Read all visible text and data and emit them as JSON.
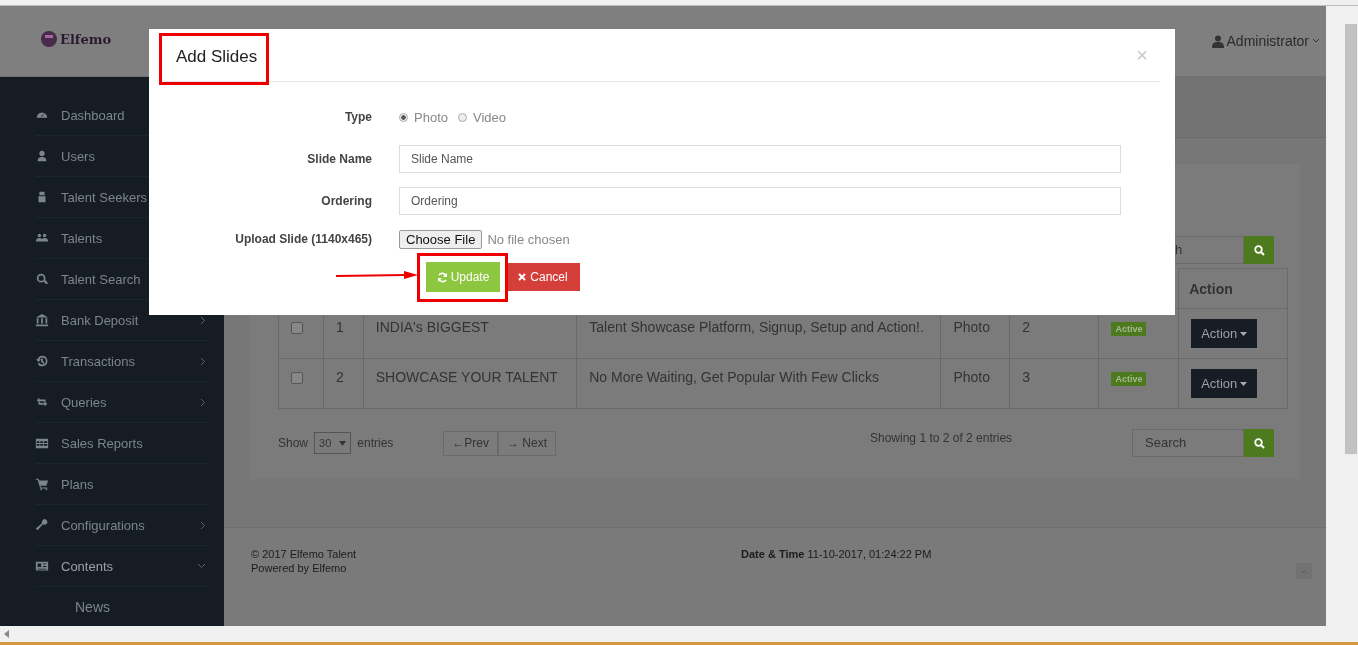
{
  "header": {
    "logo": "Elfemo",
    "user": "Administrator"
  },
  "sidebar": {
    "items": [
      {
        "label": "Dashboard"
      },
      {
        "label": "Users"
      },
      {
        "label": "Talent Seekers"
      },
      {
        "label": "Talents"
      },
      {
        "label": "Talent Search"
      },
      {
        "label": "Bank Deposit",
        "expanded": false
      },
      {
        "label": "Transactions",
        "expanded": false
      },
      {
        "label": "Queries",
        "expanded": false
      },
      {
        "label": "Sales Reports"
      },
      {
        "label": "Plans"
      },
      {
        "label": "Configurations",
        "expanded": false
      },
      {
        "label": "Contents",
        "expanded": true,
        "children": [
          {
            "label": "News"
          }
        ]
      }
    ]
  },
  "table": {
    "search_visible_text": "h",
    "columns": [
      {
        "label": "Action"
      }
    ],
    "rows": [
      {
        "checked": false,
        "number": "1",
        "title": "INDIA's BIGGEST",
        "description": "Talent Showcase Platform, Signup, Setup and Action!.",
        "type": "Photo",
        "ordering": "2",
        "status": "Active",
        "action": "Action"
      },
      {
        "checked": false,
        "number": "2",
        "title": "SHOWCASE YOUR TALENT",
        "description": "No More Waiting, Get Popular With Few Clicks",
        "type": "Photo",
        "ordering": "3",
        "status": "Active",
        "action": "Action"
      }
    ]
  },
  "pagination": {
    "show_label": "Show",
    "page_size": "30",
    "entries_label": "entries",
    "prev": "←Prev",
    "next": "→ Next",
    "info": "Showing 1 to 2 of 2 entries",
    "search_placeholder": "Search"
  },
  "footer": {
    "copyright": "© 2017 Elfemo Talent",
    "powered": "Powered by Elfemo",
    "datetime": "**Date & Time** 11-10-2017, 01:24:22 PM"
  },
  "modal": {
    "title": "Add Slides",
    "close": "×",
    "type_label": "Type",
    "type_options": [
      {
        "label": "Photo",
        "selected": true
      },
      {
        "label": "Video",
        "selected": false
      }
    ],
    "slide_name_label": "Slide Name",
    "slide_name_placeholder": "Slide Name",
    "ordering_label": "Ordering",
    "ordering_placeholder": "Ordering",
    "upload_label": "Upload Slide (1140x465)",
    "choose_file": "Choose File",
    "no_file": "No file chosen",
    "update": "Update",
    "cancel": "Cancel"
  }
}
